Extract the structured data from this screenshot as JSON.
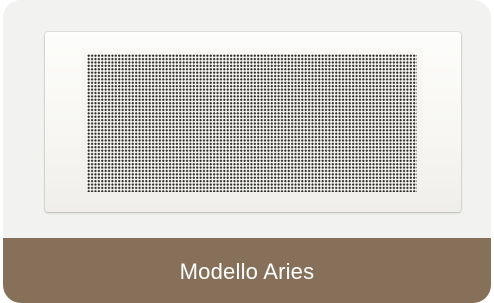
{
  "caption": {
    "label": "Modello Aries"
  },
  "product": {
    "image": "white-ventilation-grille",
    "pattern": "perforated-dot-grid"
  },
  "colors": {
    "caption_bg": "#86705a",
    "caption_text": "#ffffff",
    "card_bg": "#f3f3f1",
    "grille": "#f8f7f4",
    "perforation": "#2a2a2a"
  }
}
